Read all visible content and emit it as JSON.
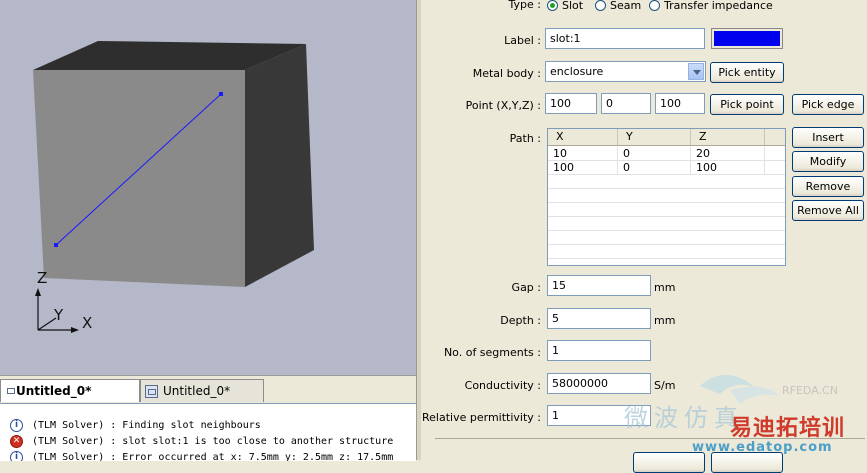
{
  "viewport": {
    "axes": {
      "z": "Z",
      "y": "Y",
      "x": "X"
    }
  },
  "tabs": [
    {
      "label": "Untitled_0*",
      "active": true
    },
    {
      "label": "Untitled_0*",
      "active": false
    }
  ],
  "log": [
    {
      "icon": "info-icon",
      "text": "(TLM Solver) : Finding slot neighbours"
    },
    {
      "icon": "error-icon",
      "text": "(TLM Solver) : slot slot:1 is too close to another structure"
    },
    {
      "icon": "info-icon",
      "text": "(TLM Solver) : Error occurred at x: 7.5mm y: 2.5mm z: 17.5mm"
    }
  ],
  "form": {
    "type": {
      "label": "Type :",
      "options": [
        {
          "label": "Slot",
          "selected": true
        },
        {
          "label": "Seam",
          "selected": false
        },
        {
          "label": "Transfer impedance",
          "selected": false
        }
      ]
    },
    "label_field": {
      "label": "Label :",
      "value": "slot:1",
      "color": "#0000ee"
    },
    "metal_body": {
      "label": "Metal body :",
      "value": "enclosure",
      "button": "Pick entity"
    },
    "point": {
      "label": "Point (X,Y,Z) :",
      "x": "100",
      "y": "0",
      "z": "100",
      "pick_point": "Pick point",
      "pick_edge": "Pick edge"
    },
    "path": {
      "label": "Path :",
      "columns": [
        "X",
        "Y",
        "Z"
      ],
      "rows": [
        [
          "10",
          "0",
          "20"
        ],
        [
          "100",
          "0",
          "100"
        ]
      ],
      "buttons": {
        "insert": "Insert",
        "modify": "Modify",
        "remove": "Remove",
        "remove_all": "Remove All"
      }
    },
    "gap": {
      "label": "Gap :",
      "value": "15",
      "unit": "mm"
    },
    "depth": {
      "label": "Depth :",
      "value": "5",
      "unit": "mm"
    },
    "segments": {
      "label": "No. of segments :",
      "value": "1"
    },
    "conductivity": {
      "label": "Conductivity :",
      "value": "58000000",
      "unit": "S/m"
    },
    "permittivity": {
      "label": "Relative permittivity :",
      "value": "1"
    }
  },
  "watermark": {
    "top_text": "RFEDA.CN",
    "cn_left": "微波仿真",
    "cn_right": "易迪拓培训",
    "url": "www.edatop.com"
  }
}
